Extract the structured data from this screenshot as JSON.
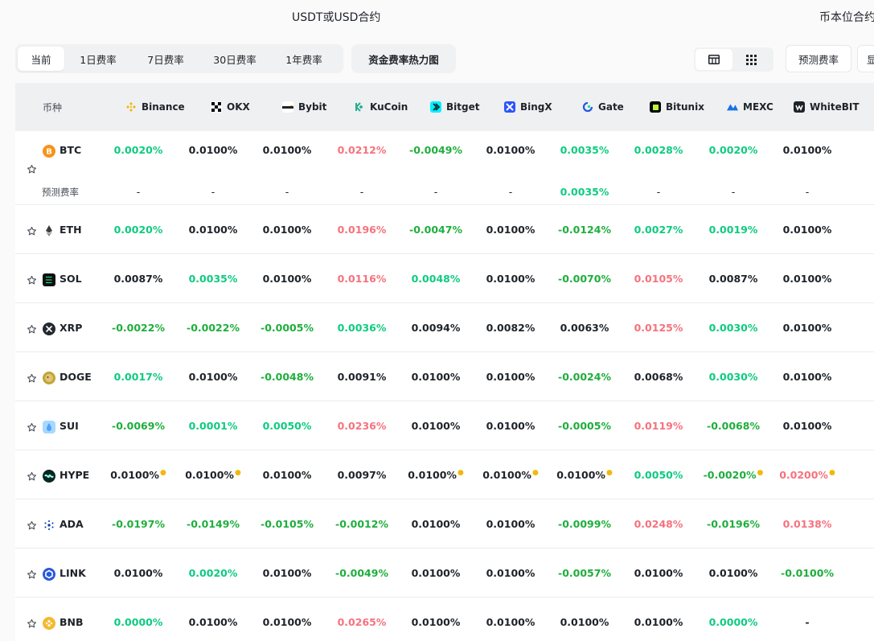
{
  "sections": {
    "usdt_title": "USDT或USD合约",
    "coin_title": "币本位合约"
  },
  "tabs": [
    "当前",
    "1日费率",
    "7日费率",
    "30日费率",
    "1年费率"
  ],
  "heatmap_label": "资金费率热力图",
  "predict_label": "预测费率",
  "show_label": "显示",
  "coin_header": "币种",
  "predict_row_label": "预测费率",
  "exchanges": [
    "Binance",
    "OKX",
    "Bybit",
    "KuCoin",
    "Bitget",
    "BingX",
    "Gate",
    "Bitunix",
    "MEXC",
    "WhiteBIT"
  ],
  "colors": {
    "positive": "#0ecb81",
    "negative": "#1eae3c",
    "high": "#f6727e",
    "neutral": "#1e2329",
    "marker": "#f0b90b"
  },
  "rows": [
    {
      "sym": "BTC",
      "icon": "btc-icon",
      "rates": [
        {
          "v": "0.0020%",
          "c": "pos"
        },
        {
          "v": "0.0100%",
          "c": "neu"
        },
        {
          "v": "0.0100%",
          "c": "neu"
        },
        {
          "v": "0.0212%",
          "c": "red"
        },
        {
          "v": "-0.0049%",
          "c": "neg"
        },
        {
          "v": "0.0100%",
          "c": "neu"
        },
        {
          "v": "0.0035%",
          "c": "pos"
        },
        {
          "v": "0.0028%",
          "c": "pos"
        },
        {
          "v": "0.0020%",
          "c": "pos"
        },
        {
          "v": "0.0100%",
          "c": "neu"
        }
      ],
      "predicted": [
        {
          "v": "-",
          "c": "pred"
        },
        {
          "v": "-",
          "c": "pred"
        },
        {
          "v": "-",
          "c": "pred"
        },
        {
          "v": "-",
          "c": "pred"
        },
        {
          "v": "-",
          "c": "pred"
        },
        {
          "v": "-",
          "c": "pred"
        },
        {
          "v": "0.0035%",
          "c": "pos"
        },
        {
          "v": "-",
          "c": "pred"
        },
        {
          "v": "-",
          "c": "pred"
        },
        {
          "v": "-",
          "c": "pred"
        }
      ]
    },
    {
      "sym": "ETH",
      "icon": "eth-icon",
      "rates": [
        {
          "v": "0.0020%",
          "c": "pos"
        },
        {
          "v": "0.0100%",
          "c": "neu"
        },
        {
          "v": "0.0100%",
          "c": "neu"
        },
        {
          "v": "0.0196%",
          "c": "red"
        },
        {
          "v": "-0.0047%",
          "c": "neg"
        },
        {
          "v": "0.0100%",
          "c": "neu"
        },
        {
          "v": "-0.0124%",
          "c": "neg"
        },
        {
          "v": "0.0027%",
          "c": "pos"
        },
        {
          "v": "0.0019%",
          "c": "pos"
        },
        {
          "v": "0.0100%",
          "c": "neu"
        }
      ]
    },
    {
      "sym": "SOL",
      "icon": "sol-icon",
      "rates": [
        {
          "v": "0.0087%",
          "c": "neu"
        },
        {
          "v": "0.0035%",
          "c": "pos"
        },
        {
          "v": "0.0100%",
          "c": "neu"
        },
        {
          "v": "0.0116%",
          "c": "red"
        },
        {
          "v": "0.0048%",
          "c": "pos"
        },
        {
          "v": "0.0100%",
          "c": "neu"
        },
        {
          "v": "-0.0070%",
          "c": "neg"
        },
        {
          "v": "0.0105%",
          "c": "red"
        },
        {
          "v": "0.0087%",
          "c": "neu"
        },
        {
          "v": "0.0100%",
          "c": "neu"
        }
      ]
    },
    {
      "sym": "XRP",
      "icon": "xrp-icon",
      "rates": [
        {
          "v": "-0.0022%",
          "c": "neg"
        },
        {
          "v": "-0.0022%",
          "c": "neg"
        },
        {
          "v": "-0.0005%",
          "c": "neg"
        },
        {
          "v": "0.0036%",
          "c": "pos"
        },
        {
          "v": "0.0094%",
          "c": "neu"
        },
        {
          "v": "0.0082%",
          "c": "neu"
        },
        {
          "v": "0.0063%",
          "c": "neu"
        },
        {
          "v": "0.0125%",
          "c": "red"
        },
        {
          "v": "0.0030%",
          "c": "pos"
        },
        {
          "v": "0.0100%",
          "c": "neu"
        }
      ]
    },
    {
      "sym": "DOGE",
      "icon": "doge-icon",
      "rates": [
        {
          "v": "0.0017%",
          "c": "pos"
        },
        {
          "v": "0.0100%",
          "c": "neu"
        },
        {
          "v": "-0.0048%",
          "c": "neg"
        },
        {
          "v": "0.0091%",
          "c": "neu"
        },
        {
          "v": "0.0100%",
          "c": "neu"
        },
        {
          "v": "0.0100%",
          "c": "neu"
        },
        {
          "v": "-0.0024%",
          "c": "neg"
        },
        {
          "v": "0.0068%",
          "c": "neu"
        },
        {
          "v": "0.0030%",
          "c": "pos"
        },
        {
          "v": "0.0100%",
          "c": "neu"
        }
      ]
    },
    {
      "sym": "SUI",
      "icon": "sui-icon",
      "rates": [
        {
          "v": "-0.0069%",
          "c": "neg"
        },
        {
          "v": "0.0001%",
          "c": "pos"
        },
        {
          "v": "0.0050%",
          "c": "pos"
        },
        {
          "v": "0.0236%",
          "c": "red"
        },
        {
          "v": "0.0100%",
          "c": "neu"
        },
        {
          "v": "0.0100%",
          "c": "neu"
        },
        {
          "v": "-0.0005%",
          "c": "neg"
        },
        {
          "v": "0.0119%",
          "c": "red"
        },
        {
          "v": "-0.0068%",
          "c": "neg"
        },
        {
          "v": "0.0100%",
          "c": "neu"
        }
      ]
    },
    {
      "sym": "HYPE",
      "icon": "hype-icon",
      "rates": [
        {
          "v": "0.0100%",
          "c": "neu",
          "m": true
        },
        {
          "v": "0.0100%",
          "c": "neu",
          "m": true
        },
        {
          "v": "0.0100%",
          "c": "neu"
        },
        {
          "v": "0.0097%",
          "c": "neu"
        },
        {
          "v": "0.0100%",
          "c": "neu",
          "m": true
        },
        {
          "v": "0.0100%",
          "c": "neu",
          "m": true
        },
        {
          "v": "0.0100%",
          "c": "neu",
          "m": true
        },
        {
          "v": "0.0050%",
          "c": "pos"
        },
        {
          "v": "-0.0020%",
          "c": "neg",
          "m": true
        },
        {
          "v": "0.0200%",
          "c": "red",
          "m": true
        }
      ]
    },
    {
      "sym": "ADA",
      "icon": "ada-icon",
      "rates": [
        {
          "v": "-0.0197%",
          "c": "neg"
        },
        {
          "v": "-0.0149%",
          "c": "neg"
        },
        {
          "v": "-0.0105%",
          "c": "neg"
        },
        {
          "v": "-0.0012%",
          "c": "neg"
        },
        {
          "v": "0.0100%",
          "c": "neu"
        },
        {
          "v": "0.0100%",
          "c": "neu"
        },
        {
          "v": "-0.0099%",
          "c": "neg"
        },
        {
          "v": "0.0248%",
          "c": "red"
        },
        {
          "v": "-0.0196%",
          "c": "neg"
        },
        {
          "v": "0.0138%",
          "c": "red"
        }
      ]
    },
    {
      "sym": "LINK",
      "icon": "link-icon",
      "rates": [
        {
          "v": "0.0100%",
          "c": "neu"
        },
        {
          "v": "0.0020%",
          "c": "pos"
        },
        {
          "v": "0.0100%",
          "c": "neu"
        },
        {
          "v": "-0.0049%",
          "c": "neg"
        },
        {
          "v": "0.0100%",
          "c": "neu"
        },
        {
          "v": "0.0100%",
          "c": "neu"
        },
        {
          "v": "-0.0057%",
          "c": "neg"
        },
        {
          "v": "0.0100%",
          "c": "neu"
        },
        {
          "v": "0.0100%",
          "c": "neu"
        },
        {
          "v": "-0.0100%",
          "c": "neg"
        }
      ]
    },
    {
      "sym": "BNB",
      "icon": "bnb-icon",
      "rates": [
        {
          "v": "0.0000%",
          "c": "pos"
        },
        {
          "v": "0.0100%",
          "c": "neu"
        },
        {
          "v": "0.0100%",
          "c": "neu"
        },
        {
          "v": "0.0265%",
          "c": "red"
        },
        {
          "v": "0.0100%",
          "c": "neu"
        },
        {
          "v": "0.0100%",
          "c": "neu"
        },
        {
          "v": "0.0100%",
          "c": "neu"
        },
        {
          "v": "0.0100%",
          "c": "neu"
        },
        {
          "v": "0.0000%",
          "c": "pos"
        },
        {
          "v": "-",
          "c": "neu"
        }
      ]
    }
  ]
}
